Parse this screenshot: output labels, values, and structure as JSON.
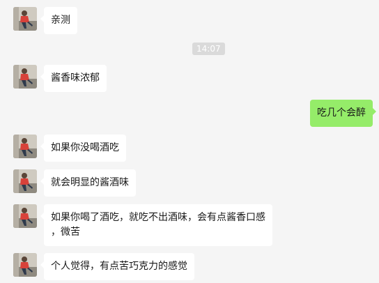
{
  "timestamp": "14:07",
  "messages": [
    {
      "side": "left",
      "text": "亲测"
    },
    {
      "side": "left",
      "text": "酱香味浓郁"
    },
    {
      "side": "right",
      "text": "吃几个会醉"
    },
    {
      "side": "left",
      "text": "如果你没喝酒吃"
    },
    {
      "side": "left",
      "text": "就会明显的酱酒味"
    },
    {
      "side": "left",
      "text": "如果你喝了酒吃，就吃不出酒味，会有点酱香口感\n，微苦"
    },
    {
      "side": "left",
      "text": "个人觉得，有点苦巧克力的感觉"
    }
  ],
  "colors": {
    "background": "#f5f5f5",
    "incoming_bubble": "#ffffff",
    "outgoing_bubble": "#95ec69",
    "timestamp_bg": "#dadada"
  }
}
